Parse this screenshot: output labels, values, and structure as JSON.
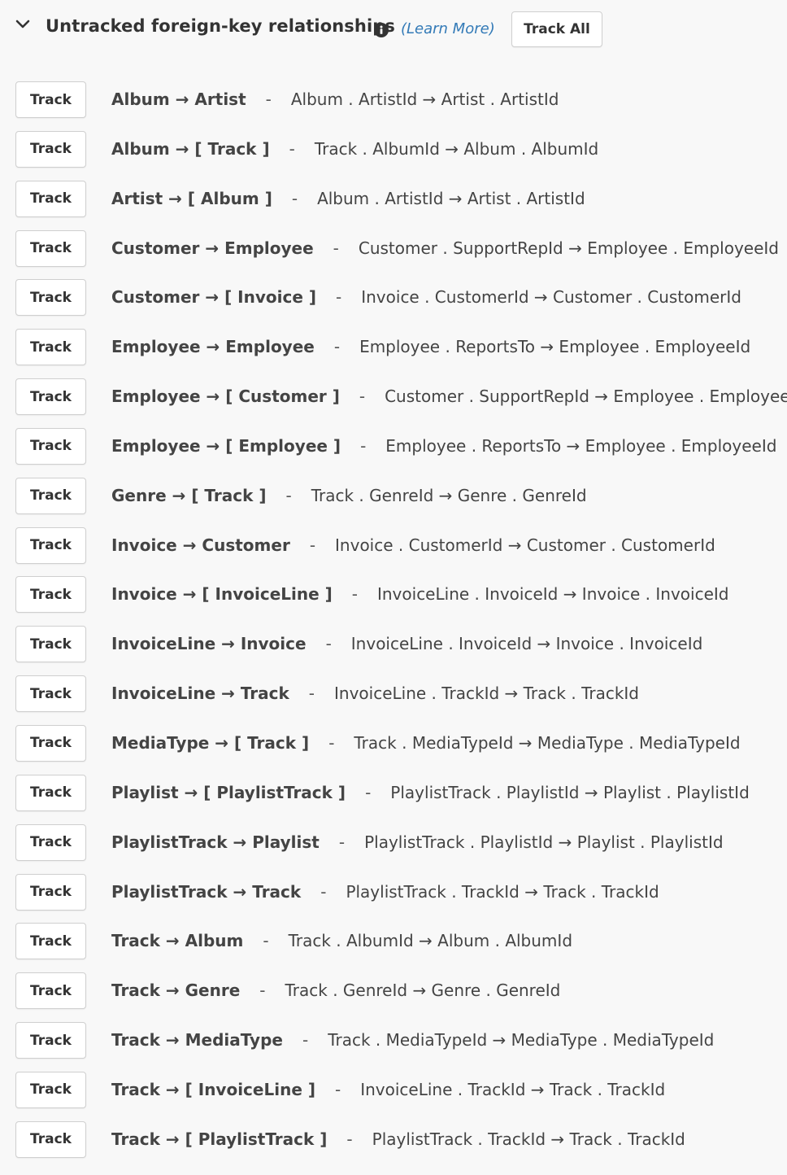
{
  "header": {
    "title": "Untracked foreign-key relationships",
    "learn_more": "(Learn More)",
    "track_all": "Track All"
  },
  "track_label": "Track",
  "separator": "-",
  "relationships": [
    {
      "name": "Album → Artist",
      "mapping": "Album . ArtistId  → Artist . ArtistId"
    },
    {
      "name": "Album → [ Track ]",
      "mapping": "Track . AlbumId  → Album . AlbumId"
    },
    {
      "name": "Artist → [ Album ]",
      "mapping": "Album . ArtistId  → Artist . ArtistId"
    },
    {
      "name": "Customer → Employee",
      "mapping": "Customer . SupportRepId  → Employee . EmployeeId"
    },
    {
      "name": "Customer → [ Invoice ]",
      "mapping": "Invoice . CustomerId  → Customer . CustomerId"
    },
    {
      "name": "Employee → Employee",
      "mapping": "Employee . ReportsTo  → Employee . EmployeeId"
    },
    {
      "name": "Employee → [ Customer ]",
      "mapping": "Customer . SupportRepId  → Employee . EmployeeId"
    },
    {
      "name": "Employee → [ Employee ]",
      "mapping": "Employee . ReportsTo  → Employee . EmployeeId"
    },
    {
      "name": "Genre → [ Track ]",
      "mapping": "Track . GenreId  → Genre . GenreId"
    },
    {
      "name": "Invoice → Customer",
      "mapping": "Invoice . CustomerId  → Customer . CustomerId"
    },
    {
      "name": "Invoice → [ InvoiceLine ]",
      "mapping": "InvoiceLine . InvoiceId  → Invoice . InvoiceId"
    },
    {
      "name": "InvoiceLine → Invoice",
      "mapping": "InvoiceLine . InvoiceId  → Invoice . InvoiceId"
    },
    {
      "name": "InvoiceLine → Track",
      "mapping": "InvoiceLine . TrackId  → Track . TrackId"
    },
    {
      "name": "MediaType → [ Track ]",
      "mapping": "Track . MediaTypeId  → MediaType . MediaTypeId"
    },
    {
      "name": "Playlist → [ PlaylistTrack ]",
      "mapping": "PlaylistTrack . PlaylistId  → Playlist . PlaylistId"
    },
    {
      "name": "PlaylistTrack → Playlist",
      "mapping": "PlaylistTrack . PlaylistId  → Playlist . PlaylistId"
    },
    {
      "name": "PlaylistTrack → Track",
      "mapping": "PlaylistTrack . TrackId  → Track . TrackId"
    },
    {
      "name": "Track → Album",
      "mapping": "Track . AlbumId  → Album . AlbumId"
    },
    {
      "name": "Track → Genre",
      "mapping": "Track . GenreId  → Genre . GenreId"
    },
    {
      "name": "Track → MediaType",
      "mapping": "Track . MediaTypeId  → MediaType . MediaTypeId"
    },
    {
      "name": "Track → [ InvoiceLine ]",
      "mapping": "InvoiceLine . TrackId  → Track . TrackId"
    },
    {
      "name": "Track → [ PlaylistTrack ]",
      "mapping": "PlaylistTrack . TrackId  → Track . TrackId"
    }
  ]
}
